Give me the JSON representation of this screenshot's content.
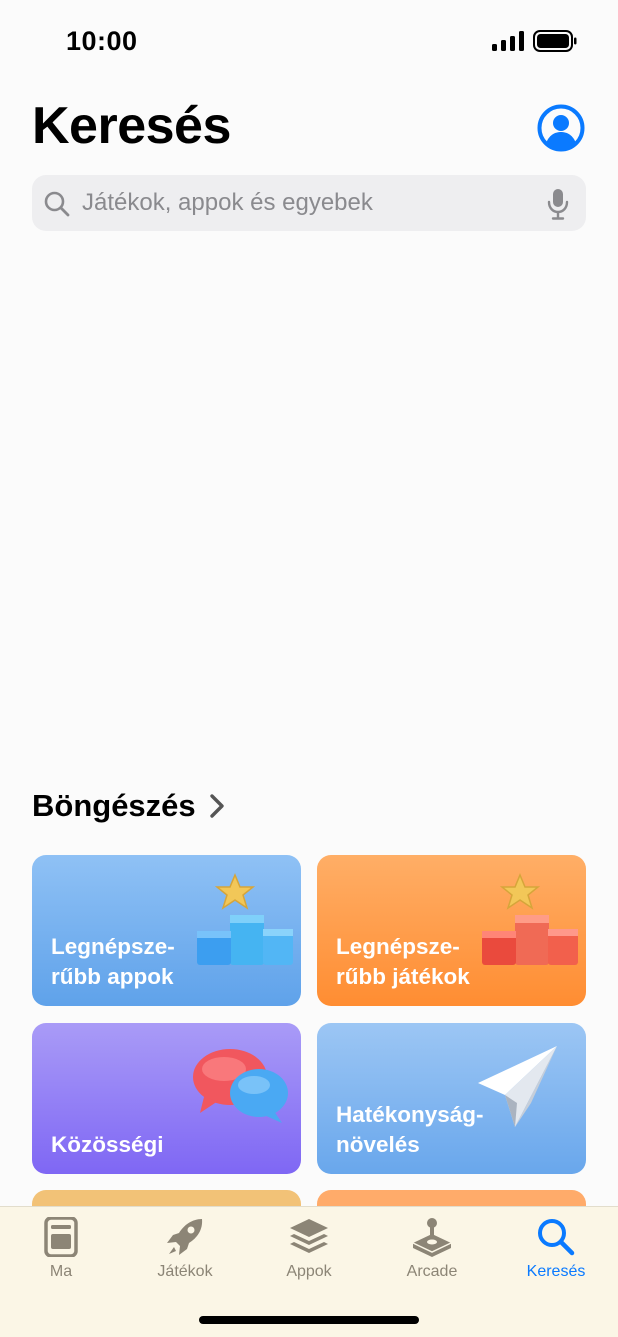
{
  "status_bar": {
    "time": "10:00"
  },
  "header": {
    "title": "Keresés"
  },
  "search": {
    "placeholder": "Játékok, appok és egyebek"
  },
  "browse": {
    "title": "Böngészés",
    "tiles": [
      {
        "label": "Legnépsze-\nrűbb appok",
        "color": "#6aa8ed"
      },
      {
        "label": "Legnépsze-\nrűbb játékok",
        "color": "#ff9640"
      },
      {
        "label": "Közösségi",
        "color": "#8c76f5"
      },
      {
        "label": "Hatékonyság-\nnövelés",
        "color": "#74adee"
      }
    ]
  },
  "tab_bar": {
    "items": [
      {
        "label": "Ma",
        "icon": "today-icon"
      },
      {
        "label": "Játékok",
        "icon": "rocket-icon"
      },
      {
        "label": "Appok",
        "icon": "layers-icon"
      },
      {
        "label": "Arcade",
        "icon": "joystick-icon"
      },
      {
        "label": "Keresés",
        "icon": "search-icon",
        "active": true
      }
    ],
    "active_color": "#0a7aff",
    "inactive_color": "#8c8576"
  }
}
